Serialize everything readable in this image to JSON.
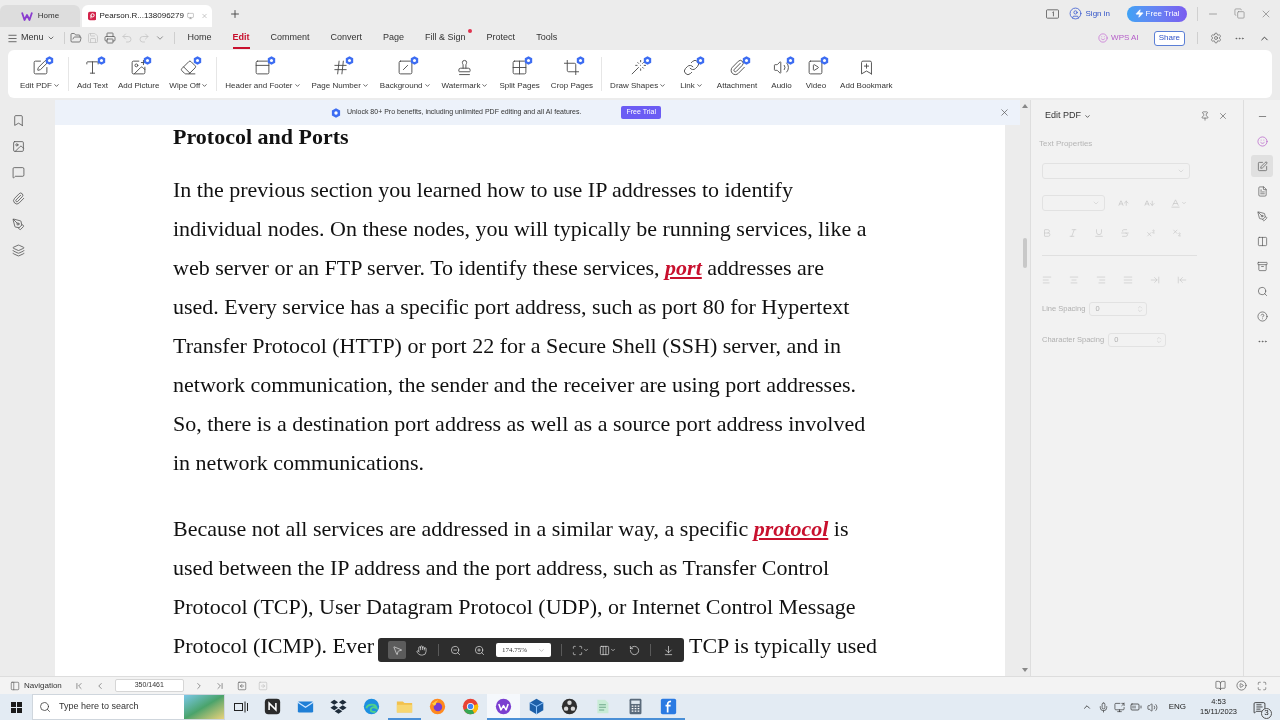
{
  "browser_tabs": [
    {
      "kind": "home",
      "label": "Home",
      "selected": false
    },
    {
      "kind": "document",
      "label": "Pearson.R...138096279",
      "selected": true
    }
  ],
  "account": {
    "sign_in": "Sign in",
    "trial_button": "Free Trial"
  },
  "menu_bar": {
    "menu": "Menu",
    "quick_tools": [
      {
        "kind": "open",
        "disabled": false
      },
      {
        "kind": "save",
        "disabled": true
      },
      {
        "kind": "print",
        "disabled": false
      },
      {
        "kind": "undo",
        "disabled": true
      },
      {
        "kind": "redo",
        "disabled": true
      }
    ],
    "tabs": [
      {
        "label": "Home",
        "selected": false,
        "badge": false
      },
      {
        "label": "Edit",
        "selected": true,
        "badge": false
      },
      {
        "label": "Comment",
        "selected": false,
        "badge": false
      },
      {
        "label": "Convert",
        "selected": false,
        "badge": false
      },
      {
        "label": "Page",
        "selected": false,
        "badge": false
      },
      {
        "label": "Fill & Sign",
        "selected": false,
        "badge": true
      },
      {
        "label": "Protect",
        "selected": false,
        "badge": false
      },
      {
        "label": "Tools",
        "selected": false,
        "badge": false
      }
    ],
    "ai": "WPS AI",
    "share": "Share"
  },
  "ribbon": {
    "groups": [
      [
        {
          "kind": "edit-pdf",
          "label": "Edit PDF",
          "dropdown": true,
          "pro": true
        }
      ],
      [
        {
          "kind": "add-text",
          "label": "Add Text",
          "dropdown": false,
          "pro": true
        },
        {
          "kind": "add-picture",
          "label": "Add Picture",
          "dropdown": false,
          "pro": true
        },
        {
          "kind": "wipe-off",
          "label": "Wipe Off",
          "dropdown": true,
          "pro": true
        }
      ],
      [
        {
          "kind": "header-footer",
          "label": "Header and Footer",
          "dropdown": true,
          "pro": true
        },
        {
          "kind": "page-number",
          "label": "Page Number",
          "dropdown": true,
          "pro": true
        },
        {
          "kind": "background",
          "label": "Background",
          "dropdown": true,
          "pro": true
        },
        {
          "kind": "watermark",
          "label": "Watermark",
          "dropdown": true,
          "pro": false
        },
        {
          "kind": "split-pages",
          "label": "Split Pages",
          "dropdown": false,
          "pro": true
        },
        {
          "kind": "crop-pages",
          "label": "Crop Pages",
          "dropdown": false,
          "pro": true
        }
      ],
      [
        {
          "kind": "draw-shapes",
          "label": "Draw Shapes",
          "dropdown": true,
          "pro": true
        },
        {
          "kind": "link",
          "label": "Link",
          "dropdown": true,
          "pro": true
        },
        {
          "kind": "attachment",
          "label": "Attachment",
          "dropdown": false,
          "pro": true
        },
        {
          "kind": "audio",
          "label": "Audio",
          "dropdown": false,
          "pro": true
        },
        {
          "kind": "video",
          "label": "Video",
          "dropdown": false,
          "pro": true
        },
        {
          "kind": "add-bookmark",
          "label": "Add Bookmark",
          "dropdown": false,
          "pro": false
        }
      ]
    ]
  },
  "banner": {
    "text": "Unlock 80+ Pro benefits, including unlimited PDF editing and all AI features.",
    "button": "Free Trial"
  },
  "document": {
    "heading": "Protocol and Ports",
    "paragraphs": [
      {
        "lines": [
          [
            "In the previous section you learned how to use IP addresses to identify"
          ],
          [
            "individual nodes. On these nodes, you will typically be running services, like a"
          ],
          [
            "web server or an FTP server. To identify these services, **port** addresses are"
          ],
          [
            "used. Every service has a specific port address, such as port 80 for Hypertext"
          ],
          [
            "Transfer Protocol (HTTP) or port 22 for a Secure Shell (SSH) server, and in"
          ],
          [
            "network communication, the sender and the receiver are using port addresses."
          ],
          [
            "So, there is a destination port address as well as a source port address involved"
          ],
          [
            "in network communications."
          ]
        ]
      },
      {
        "lines": [
          [
            "Because not all services are addressed in a similar way, a specific **protocol** is"
          ],
          [
            "used between the IP address and the port address, such as Transfer Control"
          ],
          [
            "Protocol (TCP), User Datagram Protocol (UDP), or Internet Control Message"
          ],
          [
            "Protocol (ICMP). Ever",
            "TCP is typically used"
          ]
        ]
      }
    ]
  },
  "floating_toolbar": {
    "tools": [
      {
        "kind": "select",
        "selected": true
      },
      {
        "kind": "hand",
        "selected": false
      }
    ],
    "zoom": "174.75%"
  },
  "side_panel": {
    "title": "Edit PDF",
    "section": "Text Properties",
    "disabled": true,
    "spacing_fields": [
      {
        "label": "Line Spacing",
        "value": "0"
      },
      {
        "label": "Character Spacing",
        "value": "0"
      }
    ]
  },
  "right_toolbar": [
    {
      "kind": "collapse",
      "selected": false
    },
    {
      "kind": "ai",
      "selected": false
    },
    {
      "kind": "edit",
      "selected": true
    },
    {
      "kind": "convert",
      "selected": false
    },
    {
      "kind": "sign",
      "selected": false
    },
    {
      "kind": "columns",
      "selected": false
    },
    {
      "kind": "compress",
      "selected": false
    },
    {
      "kind": "search",
      "selected": false
    },
    {
      "kind": "help",
      "selected": false
    },
    {
      "kind": "more",
      "selected": false
    }
  ],
  "status_bar": {
    "navigation": "Navigation",
    "page": "350/1461"
  },
  "taskbar": {
    "search": {
      "placeholder": "Type here to search"
    },
    "apps": [
      {
        "kind": "tile",
        "running": false,
        "active": false
      },
      {
        "kind": "mail",
        "running": false,
        "active": false
      },
      {
        "kind": "box",
        "running": false,
        "active": false
      },
      {
        "kind": "swirl",
        "running": false,
        "active": false
      },
      {
        "kind": "folder",
        "running": true,
        "active": false
      },
      {
        "kind": "flame",
        "running": false,
        "active": false
      },
      {
        "kind": "ring",
        "running": false,
        "active": false
      },
      {
        "kind": "logo",
        "running": true,
        "active": true
      },
      {
        "kind": "cube",
        "running": true,
        "active": false
      },
      {
        "kind": "aperture",
        "running": true,
        "active": false
      },
      {
        "kind": "notepad",
        "running": true,
        "active": false
      },
      {
        "kind": "calculator",
        "running": true,
        "active": false
      },
      {
        "kind": "letter",
        "running": true,
        "active": false
      }
    ],
    "language": "ENG",
    "time": "4:53",
    "date": "15/11/2023",
    "notifications": "3"
  }
}
